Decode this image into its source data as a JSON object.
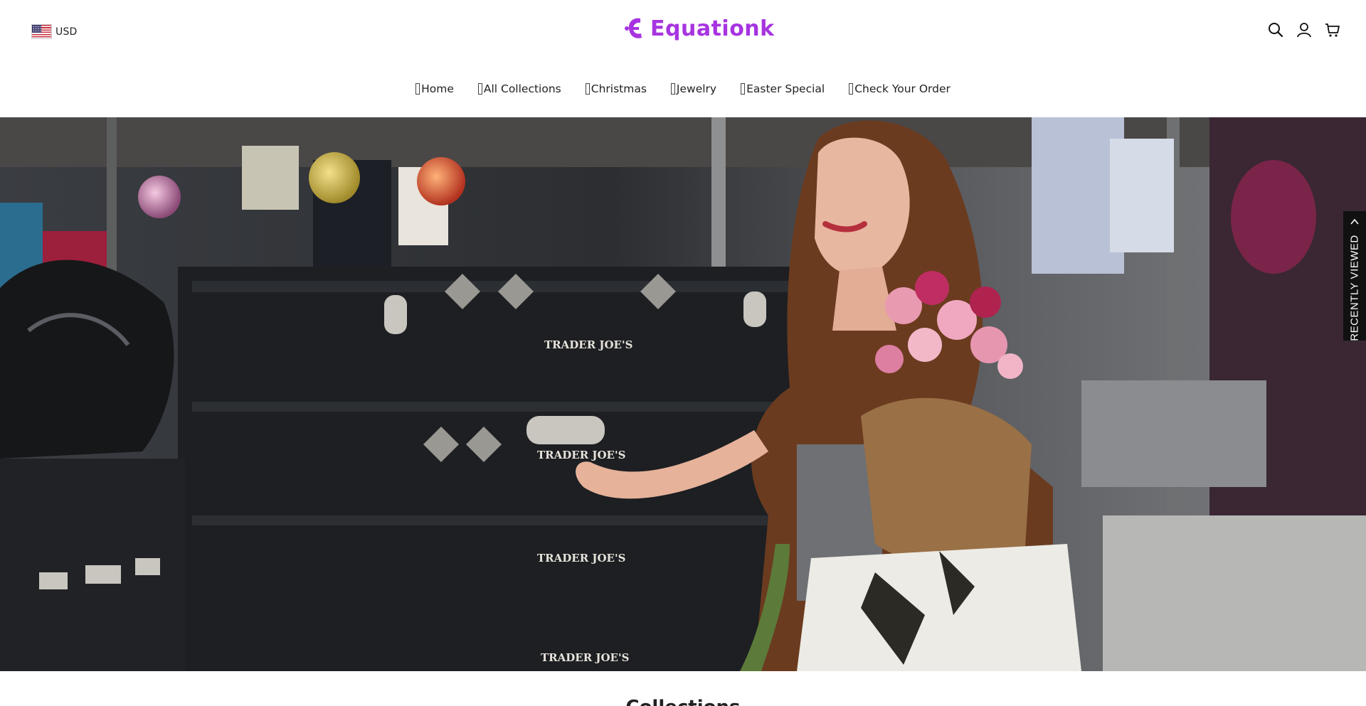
{
  "header": {
    "currency": {
      "code": "USD",
      "flag_icon": "us-flag-icon"
    },
    "logo_text": "Equationk",
    "brand_color": "#a734e0",
    "icons": [
      "search-icon",
      "account-icon",
      "cart-icon"
    ]
  },
  "nav": {
    "items": [
      {
        "label": "Home"
      },
      {
        "label": "All Collections"
      },
      {
        "label": "Christmas"
      },
      {
        "label": "Jewelry"
      },
      {
        "label": "Easter Special"
      },
      {
        "label": "Check Your Order"
      }
    ]
  },
  "hero": {
    "image_icon": "hero-photo",
    "crate_text": [
      "TRADER JOE'S",
      "TRADER JOE'S",
      "TRADER JOE'S",
      "TRADER JOE'S"
    ]
  },
  "recently_viewed": {
    "label": "RECENTLY VIEWED",
    "icon": "chevron-up-icon"
  },
  "section": {
    "title": "Collections"
  }
}
